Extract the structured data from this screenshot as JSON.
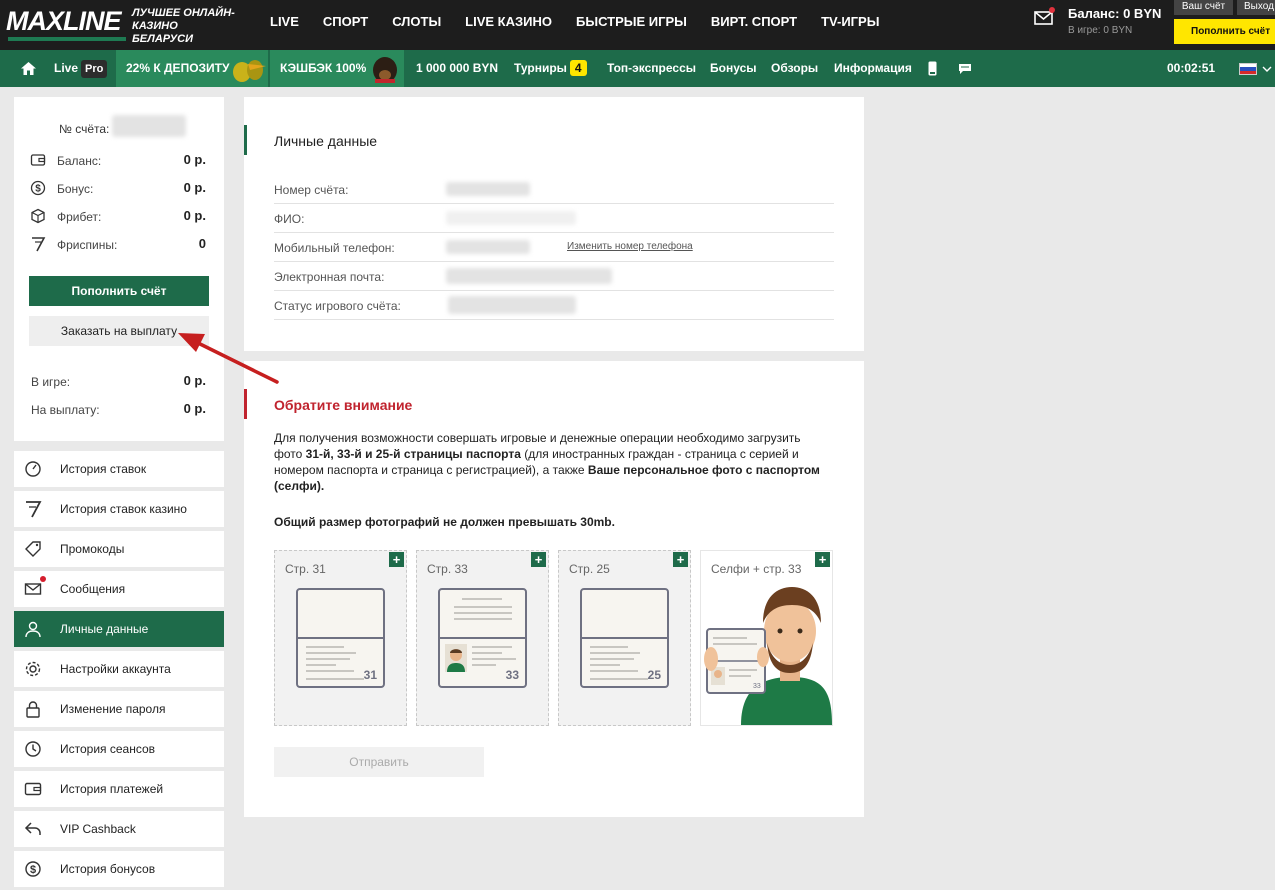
{
  "header": {
    "logo_text": "MAXLINE",
    "logo_tagline": "Лучшее онлайн-казино Беларуси",
    "nav": [
      "LIVE",
      "СПОРТ",
      "СЛОТЫ",
      "LIVE КАЗИНО",
      "БЫСТРЫЕ ИГРЫ",
      "ВИРТ. СПОРТ",
      "TV-ИГРЫ"
    ],
    "balance": "Баланс: 0 BYN",
    "in_game": "В игре: 0 BYN",
    "account_btn": "Ваш счёт",
    "exit_btn": "Выход",
    "deposit_btn": "Пополнить счёт"
  },
  "subnav": {
    "live": "Live",
    "pro": "Pro",
    "promo1": "22% К ДЕПОЗИТУ",
    "promo2": "КЭШБЭК 100%",
    "million": "1 000 000 BYN",
    "tournaments": "Турниры",
    "tournaments_count": "4",
    "top_express": "Топ-экспрессы",
    "bonuses": "Бонусы",
    "reviews": "Обзоры",
    "info": "Информация",
    "timer": "00:02:51"
  },
  "sidebar": {
    "account_label": "№ счёта:",
    "balance_label": "Баланс:",
    "balance_value": "0 р.",
    "bonus_label": "Бонус:",
    "bonus_value": "0 р.",
    "freebet_label": "Фрибет:",
    "freebet_value": "0 р.",
    "freespins_label": "Фриспины:",
    "freespins_value": "0",
    "fill_btn": "Пополнить счёт",
    "payout_btn": "Заказать на выплату",
    "ingame_label": "В игре:",
    "ingame_value": "0 р.",
    "topay_label": "На выплату:",
    "topay_value": "0 р.",
    "menu": [
      "История ставок",
      "История ставок казино",
      "Промокоды",
      "Сообщения",
      "Личные данные",
      "Настройки аккаунта",
      "Изменение пароля",
      "История сеансов",
      "История платежей",
      "VIP Cashback",
      "История бонусов"
    ]
  },
  "personal": {
    "title": "Личные данные",
    "fields": [
      "Номер счёта:",
      "ФИО:",
      "Мобильный телефон:",
      "Электронная почта:",
      "Статус игрового счёта:"
    ],
    "change_phone": "Изменить номер телефона"
  },
  "notice": {
    "title": "Обратите внимание",
    "p_start": "Для получения возможности совершать игровые и денежные операции необходимо загрузить фото ",
    "p_bold1": "31-й, 33-й и 25-й страницы паспорта",
    "p_mid": " (для иностранных граждан - страница с серией и номером паспорта и страница с регистрацией), а также ",
    "p_bold2": "Ваше персональное фото с паспортом (селфи).",
    "size_note": "Общий размер фотографий не должен превышать 30mb.",
    "slots": [
      "Стр. 31",
      "Стр. 33",
      "Стр. 25",
      "Селфи + стр. 33"
    ],
    "page_numbers": [
      "31",
      "33",
      "25",
      "33"
    ],
    "send_btn": "Отправить"
  },
  "colors": {
    "brand_green": "#1e6b4a",
    "accent_yellow": "#ffe600",
    "alert_red": "#c0232e"
  }
}
